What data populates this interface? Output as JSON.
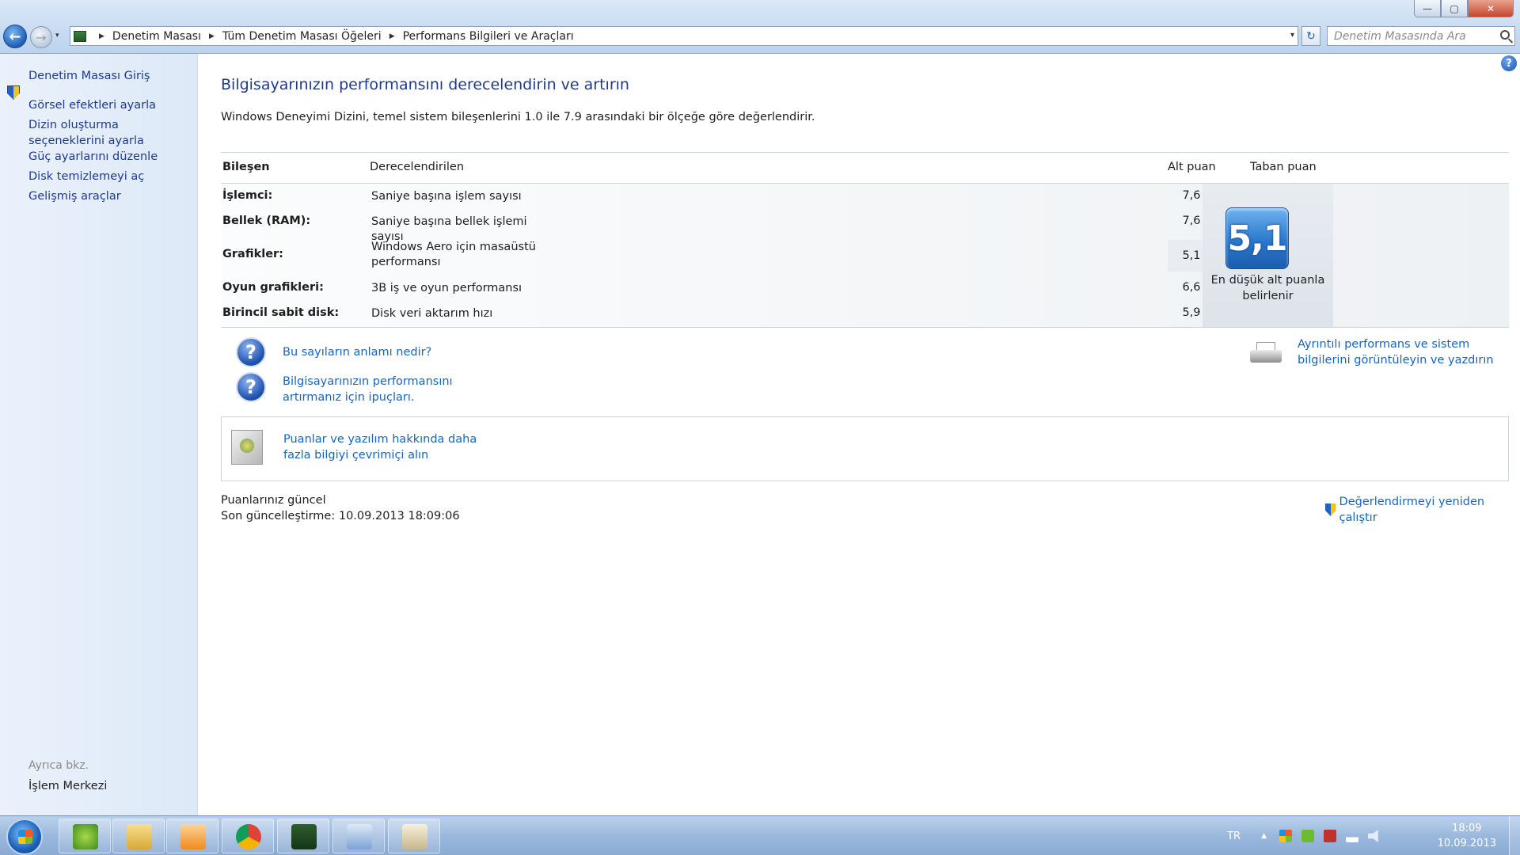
{
  "window": {
    "controls": {
      "minimize": "—",
      "maximize": "▢",
      "close": "✕"
    }
  },
  "nav": {
    "back_icon": "back-arrow-icon",
    "forward_icon": "forward-arrow-icon",
    "back_glyph": "←",
    "forward_glyph": "→",
    "dropdown_glyph": "▾"
  },
  "breadcrumb": {
    "items": [
      "Denetim Masası",
      "Tüm Denetim Masası Öğeleri",
      "Performans Bilgileri ve Araçları"
    ],
    "separator": "▶",
    "dropdown_glyph": "▾",
    "refresh_glyph": "↻"
  },
  "search": {
    "placeholder": "Denetim Masasında Ara"
  },
  "sidebar": {
    "items": [
      {
        "label": "Denetim Masası Giriş"
      },
      {
        "label": "Görsel efektleri ayarla",
        "icon": "shield-icon"
      },
      {
        "label": "Dizin oluşturma seçeneklerini ayarla"
      },
      {
        "label": "Güç ayarlarını düzenle"
      },
      {
        "label": "Disk temizlemeyi aç"
      },
      {
        "label": "Gelişmiş araçlar"
      }
    ],
    "see_also": "Ayrıca bkz.",
    "action_center": "İşlem Merkezi"
  },
  "help_glyph": "?",
  "main": {
    "title": "Bilgisayarınızın performansını derecelendirin ve artırın",
    "description": "Windows Deneyimi Dizini, temel sistem bileşenlerini 1.0 ile 7.9 arasındaki bir ölçeğe göre değerlendirir.",
    "table": {
      "headers": {
        "component": "Bileşen",
        "rated": "Derecelendirilen",
        "subscore": "Alt puan",
        "basescore": "Taban puan"
      },
      "rows": [
        {
          "component": "İşlemci:",
          "rated": "Saniye başına işlem sayısı",
          "score": "7,6"
        },
        {
          "component": "Bellek (RAM):",
          "rated": "Saniye başına bellek işlemi sayısı",
          "score": "7,6"
        },
        {
          "component": "Grafikler:",
          "rated": "Windows Aero için masaüstü performansı",
          "score": "5,1"
        },
        {
          "component": "Oyun grafikleri:",
          "rated": "3B iş ve oyun performansı",
          "score": "6,6"
        },
        {
          "component": "Birincil sabit disk:",
          "rated": "Disk veri aktarım hızı",
          "score": "5,9"
        }
      ],
      "base_score": "5,1",
      "base_caption": "En düşük alt puanla belirlenir"
    },
    "links": {
      "meaning": "Bu sayıların anlamı nedir?",
      "tips": "Bilgisayarınızın performansını artırmanız için ipuçları.",
      "details": "Ayrıntılı performans ve sistem bilgilerini görüntüleyin ve yazdırın",
      "online": "Puanlar ve yazılım hakkında daha fazla bilgiyi çevrimiçi alın",
      "rerun": "Değerlendirmeyi yeniden çalıştır"
    },
    "question_glyph": "?",
    "status": {
      "current": "Puanlarınız güncel",
      "last_update": "Son güncelleştirme: 10.09.2013 18:09:06"
    }
  },
  "taskbar": {
    "apps": [
      "utorrent-icon",
      "explorer-folder-icon",
      "media-player-icon",
      "chrome-icon",
      "monitor-app-icon",
      "control-panel-icon",
      "paint-icon"
    ],
    "language": "TR",
    "tray_arrow": "▲",
    "clock_time": "18:09",
    "clock_date": "10.09.2013"
  },
  "colors": {
    "link": "#1565c0",
    "title": "#1e3a8a",
    "accent": "#2a78cc"
  }
}
